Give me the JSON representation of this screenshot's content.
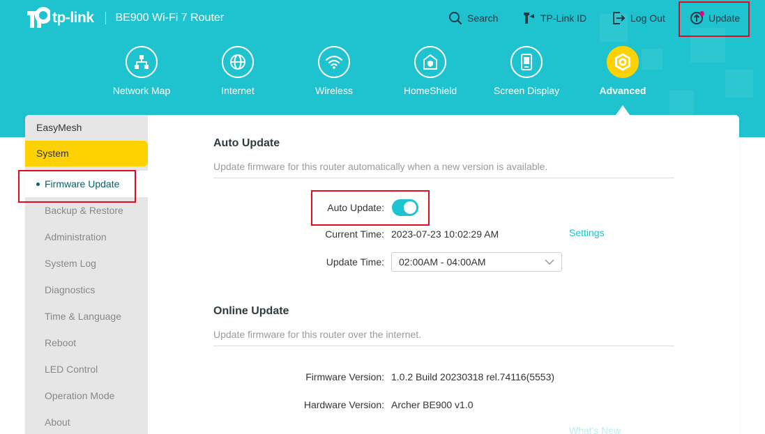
{
  "brand": {
    "logo_text": "tp-link",
    "model": "BE900 Wi-Fi 7 Router"
  },
  "toolbar": [
    {
      "name": "search",
      "label": "Search",
      "icon": "search-icon"
    },
    {
      "name": "tplink-id",
      "label": "TP-Link ID",
      "icon": "tplink-id-icon"
    },
    {
      "name": "logout",
      "label": "Log Out",
      "icon": "logout-icon"
    },
    {
      "name": "update",
      "label": "Update",
      "icon": "update-icon"
    }
  ],
  "nav": [
    {
      "label": "Network Map",
      "icon": "network-map-icon"
    },
    {
      "label": "Internet",
      "icon": "globe-icon"
    },
    {
      "label": "Wireless",
      "icon": "wifi-icon"
    },
    {
      "label": "HomeShield",
      "icon": "homeshield-icon"
    },
    {
      "label": "Screen Display",
      "icon": "screen-display-icon"
    },
    {
      "label": "Advanced",
      "icon": "advanced-gear-icon",
      "active": true
    }
  ],
  "sidebar": {
    "groups": [
      "EasyMesh",
      "System"
    ],
    "active_group": "System",
    "items": [
      "Firmware Update",
      "Backup & Restore",
      "Administration",
      "System Log",
      "Diagnostics",
      "Time & Language",
      "Reboot",
      "LED Control",
      "Operation Mode",
      "About"
    ],
    "active_item": "Firmware Update"
  },
  "auto_update": {
    "title": "Auto Update",
    "description": "Update firmware for this router automatically when a new version is available.",
    "toggle_label": "Auto Update:",
    "toggle_on": true,
    "current_time_label": "Current Time:",
    "current_time": "2023-07-23 10:02:29 AM",
    "settings_link": "Settings",
    "update_time_label": "Update Time:",
    "update_time": "02:00AM - 04:00AM"
  },
  "online_update": {
    "title": "Online Update",
    "description": "Update firmware for this router over the internet.",
    "firmware_label": "Firmware Version:",
    "firmware_value": "1.0.2 Build 20230318 rel.74116(5553)",
    "hardware_label": "Hardware Version:",
    "hardware_value": "Archer BE900 v1.0",
    "partial_link": "What's New"
  },
  "colors": {
    "banner": "#1ec3cf",
    "accent_yellow": "#fdd200",
    "highlight_box": "#e00b1c",
    "active_text": "#0a5d6c"
  }
}
